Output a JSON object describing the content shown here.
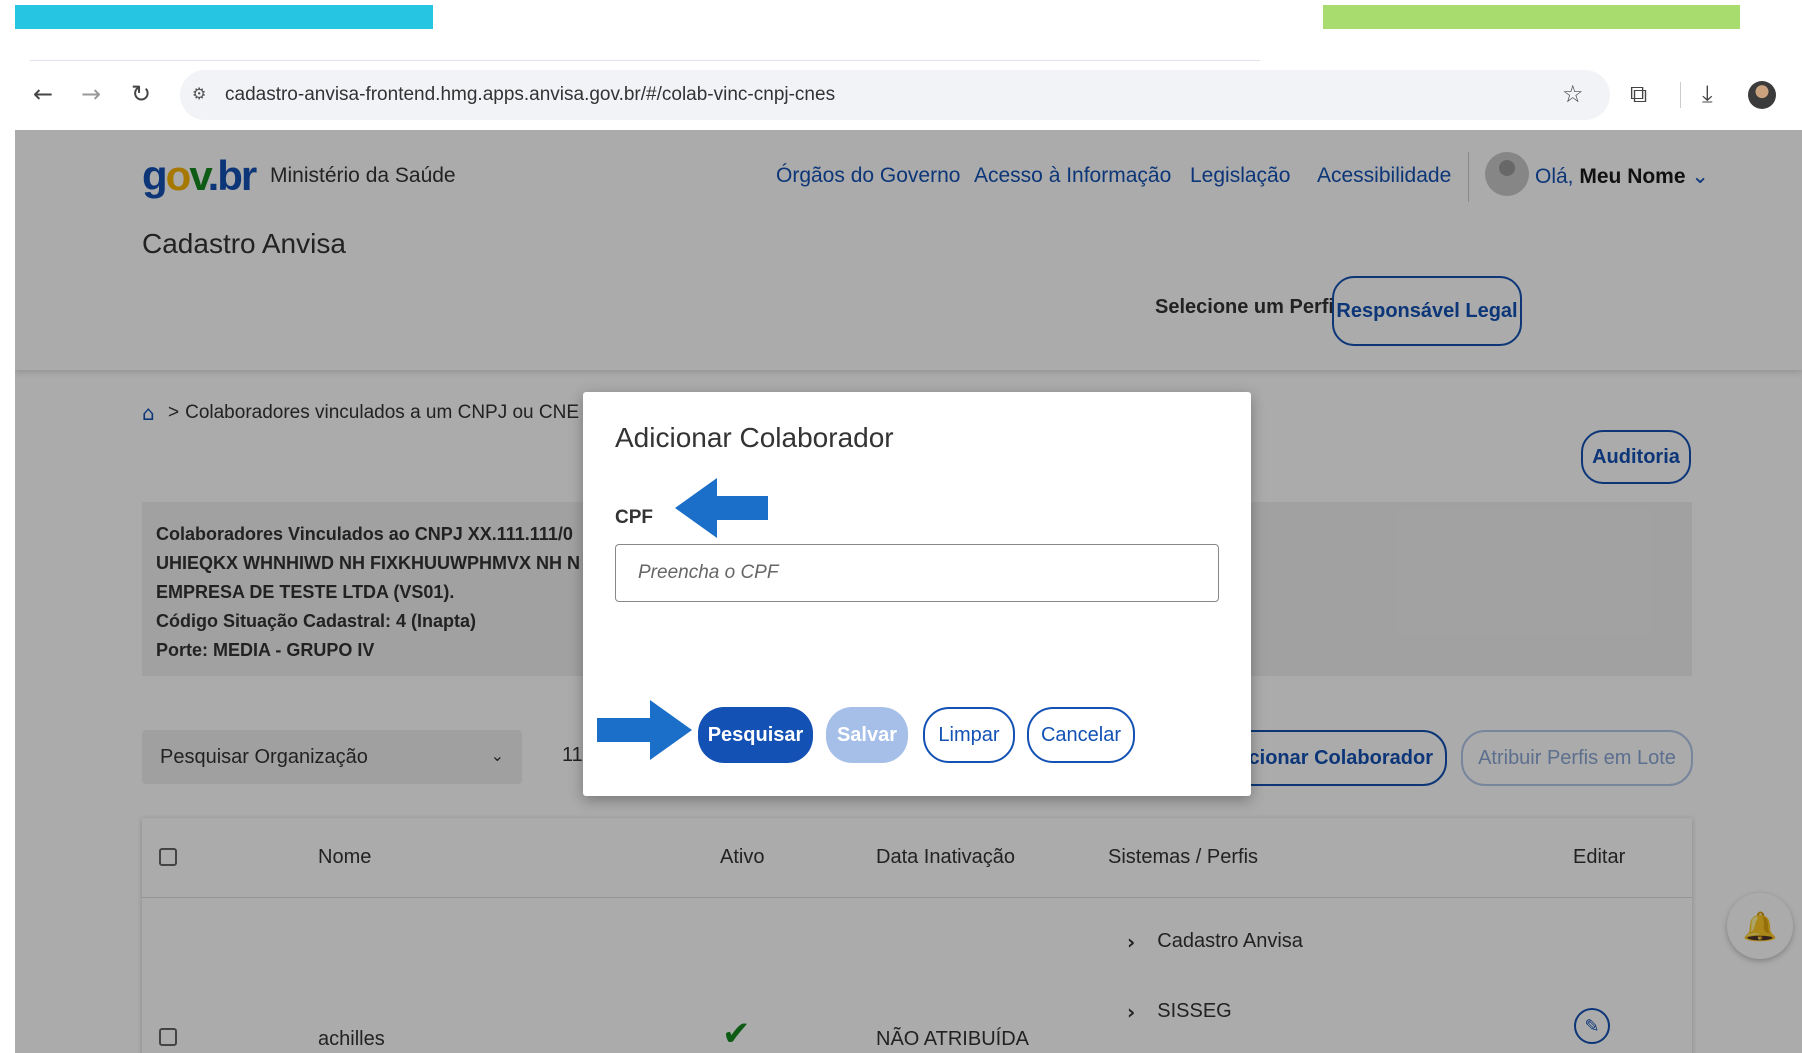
{
  "browser": {
    "url": "cadastro-anvisa-frontend.hmg.apps.anvisa.gov.br/#/colab-vinc-cnpj-cnes"
  },
  "header": {
    "logo": {
      "g": "g",
      "o": "o",
      "v": "v",
      "dot": ".",
      "br": "br"
    },
    "ministerio": "Ministério da Saúde",
    "links": [
      "Órgãos do Governo",
      "Acesso à Informação",
      "Legislação",
      "Acessibilidade"
    ],
    "greeting": "Olá,",
    "user_name": "Meu Nome",
    "site_title": "Cadastro Anvisa",
    "perfil_label": "Selecione um Perfil:",
    "perfil_value": "Responsável Legal"
  },
  "breadcrumb": {
    "separator": ">",
    "current": "Colaboradores vinculados a um CNPJ ou CNE"
  },
  "auditoria_label": "Auditoria",
  "info": {
    "lines": [
      "Colaboradores Vinculados ao CNPJ XX.111.111/0",
      "UHIEQKX WHNHIWD NH FIXKHUUWPHMVX NH N",
      "EMPRESA DE TESTE LTDA (VS01).",
      "Código Situação Cadastral: 4 (Inapta)",
      "Porte: MEDIA - GRUPO IV"
    ]
  },
  "filters": {
    "org_select": "Pesquisar Organização",
    "partial_number": "11",
    "add_colab_label": "cionar Colaborador",
    "lote_label": "Atribuir Perfis em Lote"
  },
  "table": {
    "headers": [
      "Nome",
      "Ativo",
      "Data Inativação",
      "Sistemas / Perfis",
      "Editar"
    ],
    "rows": [
      {
        "nome": "achilles",
        "data_inativacao": "NÃO ATRIBUÍDA",
        "sistemas": [
          "Cadastro Anvisa",
          "SISSEG"
        ]
      }
    ]
  },
  "modal": {
    "title": "Adicionar Colaborador",
    "cpf_label": "CPF",
    "cpf_placeholder": "Preencha o CPF",
    "buttons": {
      "pesquisar": "Pesquisar",
      "salvar": "Salvar",
      "limpar": "Limpar",
      "cancelar": "Cancelar"
    }
  },
  "colors": {
    "primary": "#1351b4",
    "arrow": "#1b6fc9",
    "bar_cyan": "#26c6e2",
    "bar_green": "#a8dc6e"
  },
  "icons": {
    "home": "home-icon",
    "bell": "bell-icon",
    "edit": "pencil-icon",
    "check": "check-icon"
  }
}
